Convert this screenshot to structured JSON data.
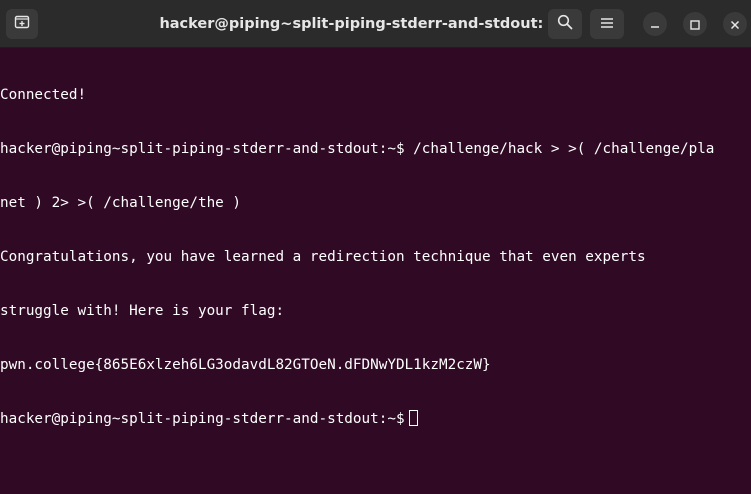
{
  "window": {
    "title": "hacker@piping~split-piping-stderr-and-stdout: ~"
  },
  "icons": {
    "new_tab": "new-tab-icon",
    "search": "search-icon",
    "menu": "hamburger-menu-icon",
    "minimize": "minimize-icon",
    "maximize": "maximize-icon",
    "close": "close-icon"
  },
  "colors": {
    "terminal_background": "#300a24",
    "titlebar_background": "#2b2b2b",
    "text": "#ffffff"
  },
  "terminal": {
    "lines": [
      "Connected!",
      "hacker@piping~split-piping-stderr-and-stdout:~$ /challenge/hack > >( /challenge/pla",
      "net ) 2> >( /challenge/the )",
      "Congratulations, you have learned a redirection technique that even experts",
      "struggle with! Here is your flag:",
      "pwn.college{865E6xlzeh6LG3odavdL82GTOeN.dFDNwYDL1kzM2czW}"
    ],
    "prompt": "hacker@piping~split-piping-stderr-and-stdout:~$"
  }
}
